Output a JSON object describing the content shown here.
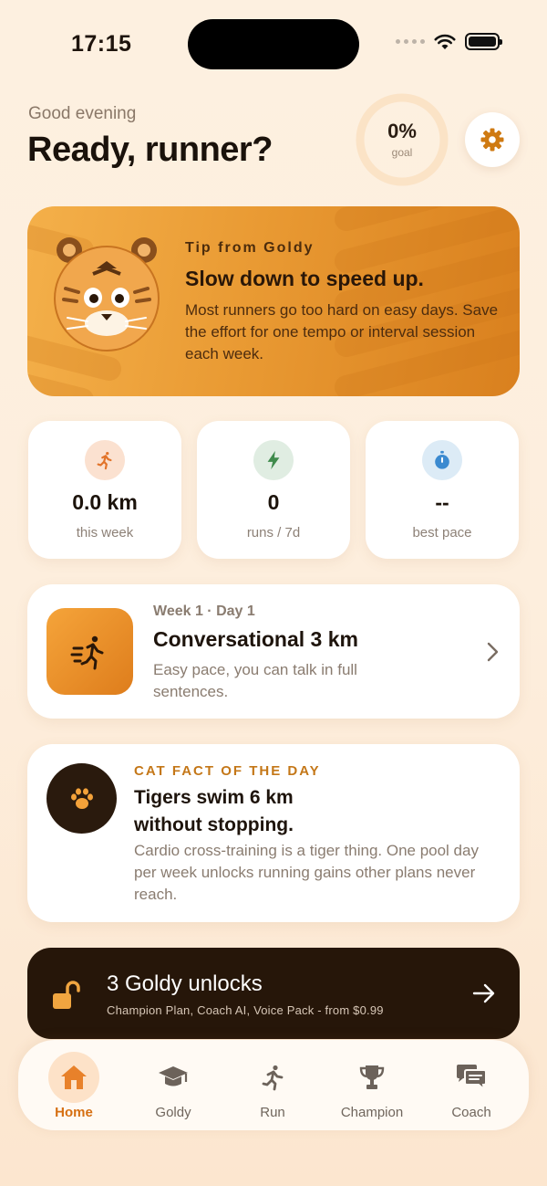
{
  "status_bar": {
    "time": "17:15"
  },
  "header": {
    "greeting": "Good evening",
    "headline": "Ready, runner?",
    "goal": {
      "percent": "0%",
      "label": "goal",
      "progress": 0
    },
    "settings_icon": "gear-icon"
  },
  "tip": {
    "eyebrow": "Tip from Goldy",
    "title": "Slow down to speed up.",
    "body": "Most runners go too hard on easy days. Save the effort for one tempo or interval session each week."
  },
  "stats": [
    {
      "icon": "runner-icon",
      "value": "0.0 km",
      "label": "this week",
      "color": "#fbe1d0"
    },
    {
      "icon": "lightning-icon",
      "value": "0",
      "label": "runs / 7d",
      "color": "#e0ede2"
    },
    {
      "icon": "stopwatch-icon",
      "value": "--",
      "label": "best pace",
      "color": "#dcebf6"
    }
  ],
  "workout": {
    "meta": "Week 1 · Day 1",
    "title": "Conversational 3 km",
    "description": "Easy pace, you can talk in full sentences."
  },
  "fact": {
    "eyebrow": "CAT FACT OF THE DAY",
    "title": "Tigers swim 6 km without stopping.",
    "body": "Cardio cross-training is a tiger thing. One pool day per week unlocks running gains other plans never reach."
  },
  "unlocks": {
    "title": "3 Goldy unlocks",
    "subtitle": "Champion Plan, Coach AI, Voice Pack - from $0.99"
  },
  "tabs": [
    {
      "label": "Home",
      "icon": "home-icon",
      "active": true
    },
    {
      "label": "Goldy",
      "icon": "graduation-cap-icon",
      "active": false
    },
    {
      "label": "Run",
      "icon": "runner-icon",
      "active": false
    },
    {
      "label": "Champion",
      "icon": "trophy-icon",
      "active": false
    },
    {
      "label": "Coach",
      "icon": "chat-bubbles-icon",
      "active": false
    }
  ],
  "colors": {
    "accent": "#d66f12",
    "tip_card": "#e99a33",
    "banner": "#261609",
    "background": "#fdf0e0"
  }
}
